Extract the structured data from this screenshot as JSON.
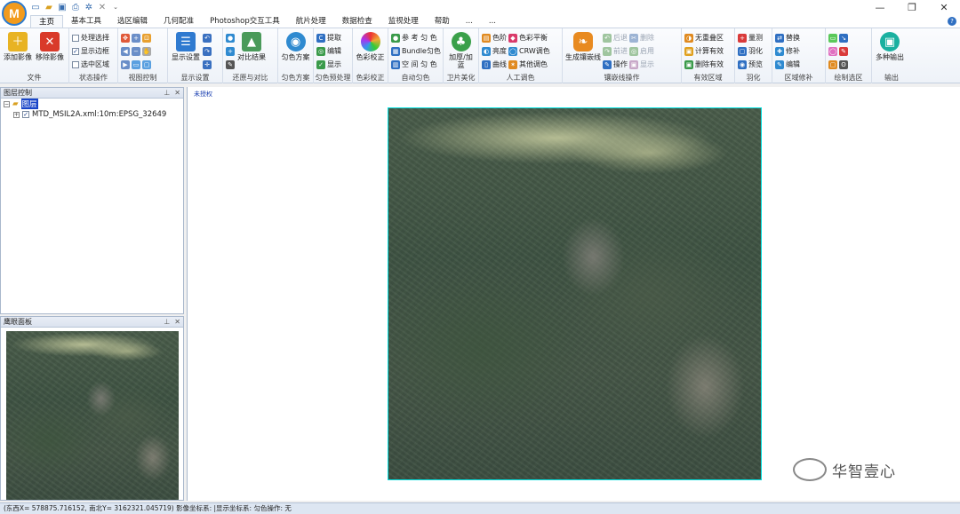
{
  "app": {
    "logo_letter": "M"
  },
  "qat": [
    "new-icon",
    "open-icon",
    "save-icon",
    "print-icon",
    "settings-icon",
    "close-icon"
  ],
  "tabs": [
    "主页",
    "基本工具",
    "选区编辑",
    "几何配准",
    "Photoshop交互工具",
    "航片处理",
    "数据检查",
    "监视处理",
    "帮助",
    "...",
    "..."
  ],
  "ribbon": {
    "file": {
      "add": "添加影像",
      "remove": "移除影像",
      "label": "文件"
    },
    "state": {
      "processed": "处理选择",
      "show_border": "显示边框",
      "select_region": "选中区域",
      "label": "状态操作"
    },
    "view": {
      "label": "视图控制"
    },
    "display": {
      "btn": "显示设置",
      "label": "显示设置"
    },
    "restore": {
      "compare": "对比结果",
      "label": "还原与对比"
    },
    "uniform": {
      "btn": "匀色方案",
      "label": "匀色方案"
    },
    "preprocess": {
      "extract": "提取",
      "edit": "编辑",
      "show": "显示",
      "label": "匀色预处理"
    },
    "correction": {
      "btn": "色彩校正",
      "label": "色彩校正"
    },
    "auto": {
      "ref": "参 考 匀 色",
      "bundle": "Bundle匀色",
      "spatial": "空 间 匀 色",
      "label": "自动匀色"
    },
    "sat": {
      "btn": "加厚/加蓝",
      "label": "卫片美化"
    },
    "manual": {
      "levels": "色阶",
      "balance": "色彩平衡",
      "brightness": "亮度",
      "crw": "CRW调色",
      "curves": "曲线",
      "other": "其他调色",
      "label": "人工调色"
    },
    "seam": {
      "gen": "生成镶嵌线",
      "back": "后退",
      "delete": "删除",
      "forward": "前进",
      "enable": "启用",
      "op": "操作",
      "show": "显示",
      "label": "镶嵌线操作"
    },
    "valid": {
      "none": "无重叠区",
      "calc": "计算有效",
      "del": "删除有效",
      "label": "有效区域"
    },
    "feather": {
      "measure": "量测",
      "feather": "羽化",
      "preview": "预览",
      "label": "羽化"
    },
    "repair": {
      "replace": "替换",
      "patch": "修补",
      "edit": "编辑",
      "label": "区域修补"
    },
    "draw": {
      "label": "绘制选区"
    },
    "output": {
      "btn": "多种输出",
      "label": "输出"
    }
  },
  "layers_panel": {
    "title": "图层控制",
    "root": "图层",
    "item": "MTD_MSIL2A.xml:10m:EPSG_32649"
  },
  "eagle_panel": {
    "title": "鹰眼面板"
  },
  "canvas": {
    "tab": "未授权"
  },
  "watermark": "华智壹心",
  "status": "(东西X= 578875.716152, 南北Y= 3162321.045719) 影像坐标系: |显示坐标系:   匀色操作: 无"
}
